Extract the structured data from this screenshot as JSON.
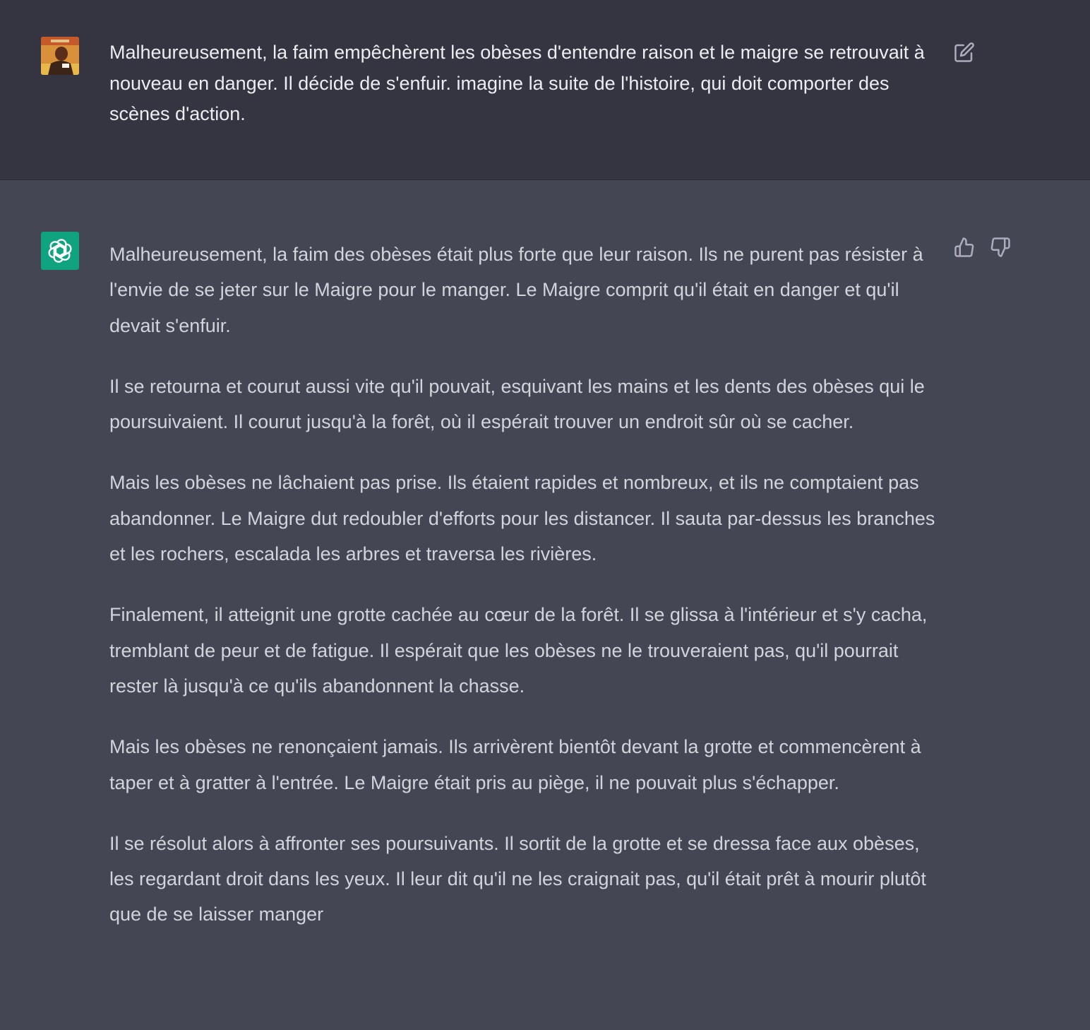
{
  "colors": {
    "user_bg": "#343541",
    "assistant_bg": "#444654",
    "bot_avatar_bg": "#10a37f",
    "icon_color": "#acacbe"
  },
  "user_message": {
    "avatar_icon": "user-avatar-image",
    "text": "Malheureusement, la faim empêchèrent les obèses d'entendre raison et le maigre se retrouvait à nouveau en danger. Il décide de s'enfuir. imagine la suite de l'histoire, qui doit comporter des scènes d'action.",
    "edit_icon": "edit-icon"
  },
  "assistant_message": {
    "avatar_icon": "openai-logo-icon",
    "paragraphs": [
      "Malheureusement, la faim des obèses était plus forte que leur raison. Ils ne purent pas résister à l'envie de se jeter sur le Maigre pour le manger. Le Maigre comprit qu'il était en danger et qu'il devait s'enfuir.",
      "Il se retourna et courut aussi vite qu'il pouvait, esquivant les mains et les dents des obèses qui le poursuivaient. Il courut jusqu'à la forêt, où il espérait trouver un endroit sûr où se cacher.",
      "Mais les obèses ne lâchaient pas prise. Ils étaient rapides et nombreux, et ils ne comptaient pas abandonner. Le Maigre dut redoubler d'efforts pour les distancer. Il sauta par-dessus les branches et les rochers, escalada les arbres et traversa les rivières.",
      "Finalement, il atteignit une grotte cachée au cœur de la forêt. Il se glissa à l'intérieur et s'y cacha, tremblant de peur et de fatigue. Il espérait que les obèses ne le trouveraient pas, qu'il pourrait rester là jusqu'à ce qu'ils abandonnent la chasse.",
      "Mais les obèses ne renonçaient jamais. Ils arrivèrent bientôt devant la grotte et commencèrent à taper et à gratter à l'entrée. Le Maigre était pris au piège, il ne pouvait plus s'échapper.",
      "Il se résolut alors à affronter ses poursuivants. Il sortit de la grotte et se dressa face aux obèses, les regardant droit dans les yeux. Il leur dit qu'il ne les craignait pas, qu'il était prêt à mourir plutôt que de se laisser manger"
    ],
    "thumbs_up_icon": "thumbs-up-icon",
    "thumbs_down_icon": "thumbs-down-icon"
  }
}
